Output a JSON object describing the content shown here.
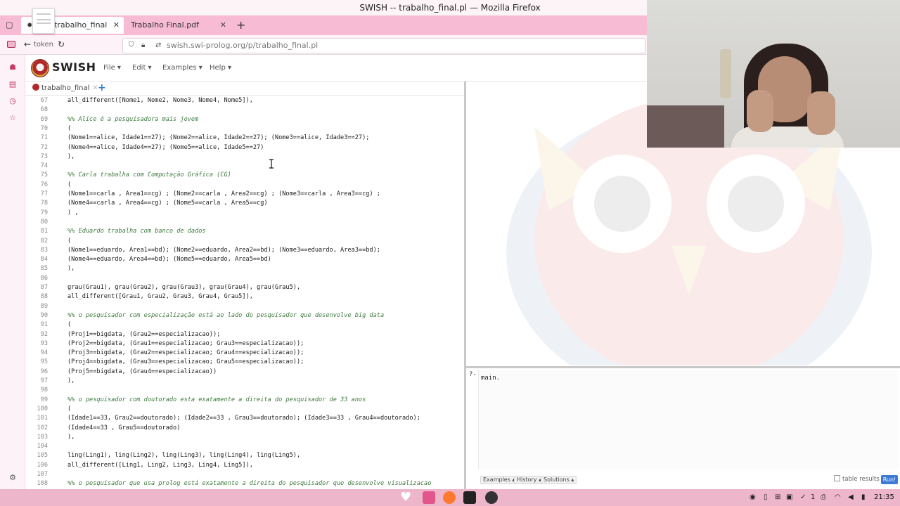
{
  "window": {
    "title": "SWISH -- trabalho_final.pl — Mozilla Firefox"
  },
  "tabs": [
    {
      "label": "H -- trabalho_final"
    },
    {
      "label": "Trabalho Final.pdf"
    }
  ],
  "browser": {
    "url_prefix": "swish.swi-prolog.org",
    "url_path": "/p/trabalho_final.pl",
    "overlay_text": "token"
  },
  "swish": {
    "logo_text": "SWISH",
    "menus": [
      "File",
      "Edit",
      "Examples",
      "Help"
    ],
    "editor_tab": "trabalho_final"
  },
  "code_lines": [
    {
      "n": "67",
      "text": "all_different([Nome1, Nome2, Nome3, Nome4, Nome5]),",
      "comment": false
    },
    {
      "n": "68",
      "text": "",
      "comment": false
    },
    {
      "n": "69",
      "text": "%% Alice é a pesquisadora mais jovem",
      "comment": true
    },
    {
      "n": "70",
      "text": "(",
      "comment": false
    },
    {
      "n": "71",
      "text": "(Nome1==alice, Idade1==27); (Nome2==alice, Idade2==27); (Nome3==alice, Idade3==27);",
      "comment": false
    },
    {
      "n": "72",
      "text": "(Nome4==alice, Idade4==27); (Nome5==alice, Idade5==27)",
      "comment": false
    },
    {
      "n": "73",
      "text": "),",
      "comment": false
    },
    {
      "n": "74",
      "text": "",
      "comment": false
    },
    {
      "n": "75",
      "text": "%% Carla trabalha com Computação Gráfica (CG)",
      "comment": true
    },
    {
      "n": "76",
      "text": "(",
      "comment": false
    },
    {
      "n": "77",
      "text": "(Nome1==carla , Area1==cg) ; (Nome2==carla , Area2==cg) ; (Nome3==carla , Area3==cg) ;",
      "comment": false
    },
    {
      "n": "78",
      "text": "(Nome4==carla , Area4==cg) ; (Nome5==carla , Area5==cg)",
      "comment": false
    },
    {
      "n": "79",
      "text": ") ,",
      "comment": false
    },
    {
      "n": "80",
      "text": "",
      "comment": false
    },
    {
      "n": "81",
      "text": "%% Eduardo trabalha com banco de dados",
      "comment": true
    },
    {
      "n": "82",
      "text": "(",
      "comment": false
    },
    {
      "n": "83",
      "text": "(Nome1==eduardo, Area1==bd); (Nome2==eduardo, Area2==bd); (Nome3==eduardo, Area3==bd);",
      "comment": false
    },
    {
      "n": "84",
      "text": "(Nome4==eduardo, Area4==bd); (Nome5==eduardo, Area5==bd)",
      "comment": false
    },
    {
      "n": "85",
      "text": "),",
      "comment": false
    },
    {
      "n": "86",
      "text": "",
      "comment": false
    },
    {
      "n": "87",
      "text": "grau(Grau1), grau(Grau2), grau(Grau3), grau(Grau4), grau(Grau5),",
      "comment": false
    },
    {
      "n": "88",
      "text": "all_different([Grau1, Grau2, Grau3, Grau4, Grau5]),",
      "comment": false
    },
    {
      "n": "89",
      "text": "",
      "comment": false
    },
    {
      "n": "90",
      "text": "%% o pesquisador com especialização está ao lado do pesquisador que desenvolve big data",
      "comment": true
    },
    {
      "n": "91",
      "text": "(",
      "comment": false
    },
    {
      "n": "92",
      "text": "(Proj1==bigdata, (Grau2==especializacao));",
      "comment": false
    },
    {
      "n": "93",
      "text": "(Proj2==bigdata, (Grau1==especializacao; Grau3==especializacao));",
      "comment": false
    },
    {
      "n": "94",
      "text": "(Proj3==bigdata, (Grau2==especializacao; Grau4==especializacao));",
      "comment": false
    },
    {
      "n": "95",
      "text": "(Proj4==bigdata, (Grau3==especializacao; Grau5==especializacao));",
      "comment": false
    },
    {
      "n": "96",
      "text": "(Proj5==bigdata, (Grau4==especializacao))",
      "comment": false
    },
    {
      "n": "97",
      "text": "),",
      "comment": false
    },
    {
      "n": "98",
      "text": "",
      "comment": false
    },
    {
      "n": "99",
      "text": "%% o pesquisador com doutorado esta exatamente a direita do pesquisador de 33 anos",
      "comment": true
    },
    {
      "n": "100",
      "text": "(",
      "comment": false
    },
    {
      "n": "101",
      "text": "(Idade1==33, Grau2==doutorado); (Idade2==33 , Grau3==doutorado); (Idade3==33 , Grau4==doutorado);",
      "comment": false
    },
    {
      "n": "102",
      "text": "(Idade4==33 , Grau5==doutorado)",
      "comment": false
    },
    {
      "n": "103",
      "text": "),",
      "comment": false
    },
    {
      "n": "104",
      "text": "",
      "comment": false
    },
    {
      "n": "105",
      "text": "ling(Ling1), ling(Ling2), ling(Ling3), ling(Ling4), ling(Ling5),",
      "comment": false
    },
    {
      "n": "106",
      "text": "all_different([Ling1, Ling2, Ling3, Ling4, Ling5]),",
      "comment": false
    },
    {
      "n": "107",
      "text": "",
      "comment": false
    },
    {
      "n": "108",
      "text": "%% o pesquisador que usa prolog está exatamente a direita do pesquisador que desenvolve visualizacao",
      "comment": true
    }
  ],
  "query": {
    "prompt": "?-",
    "text": "main.",
    "buttons": [
      "Examples",
      "History",
      "Solutions"
    ],
    "table_results_label": "table results",
    "run_label": "Run!"
  },
  "taskbar": {
    "clock": "21:35",
    "tray_numeral": "1"
  },
  "colors": {
    "tab_bar": "#f7bcd3",
    "taskbar": "#eeb6cb",
    "run_button": "#3b7bd4",
    "comment": "#3f7a3f"
  }
}
